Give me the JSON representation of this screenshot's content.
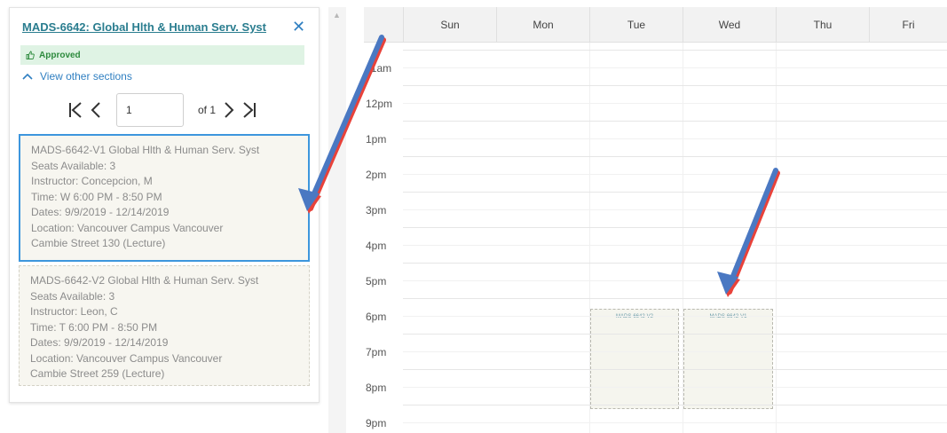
{
  "panel": {
    "course_title": "MADS-6642: Global Hlth & Human Serv. Syst",
    "close_glyph": "✕",
    "approved_label": "Approved",
    "view_other_label": "View other sections",
    "pager": {
      "first_glyph": "⏮",
      "prev_glyph": "❮",
      "page_value": "1",
      "of_text": "of 1",
      "next_glyph": "❯",
      "last_glyph": "⏭"
    },
    "sections": [
      {
        "name": "MADS-6642-V1 Global Hlth & Human Serv. Syst",
        "seats": "Seats Available: 3",
        "instructor": "Instructor: Concepcion, M",
        "time": "Time: W 6:00 PM - 8:50 PM",
        "dates": "Dates: 9/9/2019 - 12/14/2019",
        "location": "Location: Vancouver Campus Vancouver",
        "room": "Cambie Street 130 (Lecture)"
      },
      {
        "name": "MADS-6642-V2 Global Hlth & Human Serv. Syst",
        "seats": "Seats Available: 3",
        "instructor": "Instructor: Leon, C",
        "time": "Time: T 6:00 PM - 8:50 PM",
        "dates": "Dates: 9/9/2019 - 12/14/2019",
        "location": "Location: Vancouver Campus Vancouver",
        "room": "Cambie Street 259 (Lecture)"
      }
    ]
  },
  "calendar": {
    "days": [
      "Sun",
      "Mon",
      "Tue",
      "Wed",
      "Thu",
      "Fri"
    ],
    "times": [
      "11am",
      "12pm",
      "1pm",
      "2pm",
      "3pm",
      "4pm",
      "5pm",
      "6pm",
      "7pm",
      "8pm",
      "9pm"
    ],
    "events": [
      {
        "label": "MADS-6642-V2",
        "day": "Tue",
        "start": "6pm",
        "end": "8:50pm"
      },
      {
        "label": "MADS-6642-V1",
        "day": "Wed",
        "start": "6pm",
        "end": "8:50pm"
      }
    ]
  },
  "colors": {
    "accent": "#2f7fc1",
    "title": "#2a7d8f",
    "approved_bg": "#dff3e4",
    "approved_text": "#2e8b3e",
    "selected_border": "#3d96dd",
    "card_bg": "#f7f6f0",
    "arrow_blue": "#4a78c2",
    "arrow_red": "#e8423a"
  },
  "icons": {
    "close": "close-icon",
    "approved": "thumbs-up-icon",
    "view_other": "chevron-up-icon",
    "first": "first-page-icon",
    "prev": "chevron-left-icon",
    "next": "chevron-right-icon",
    "last": "last-page-icon"
  }
}
